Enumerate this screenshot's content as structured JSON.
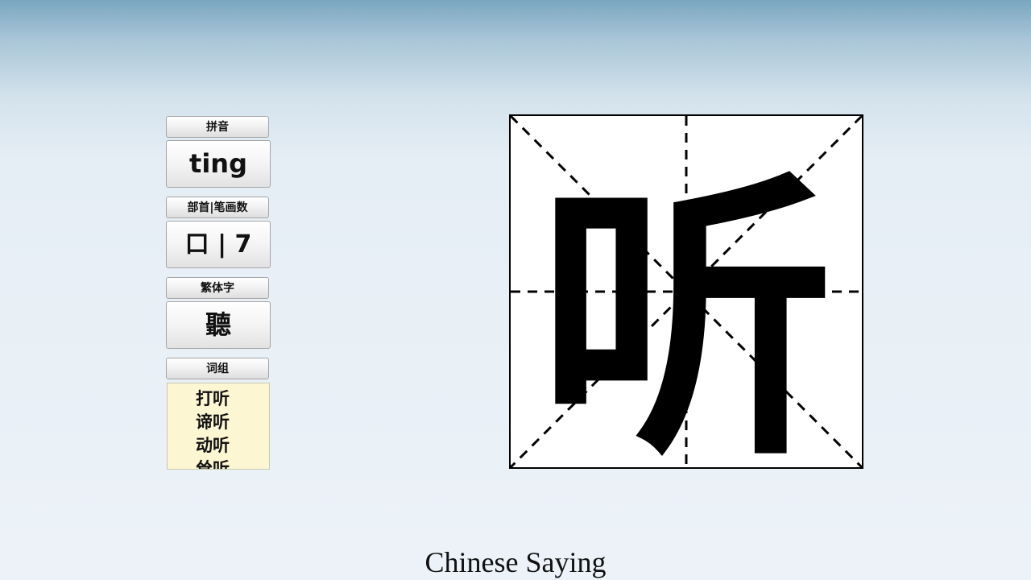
{
  "panel": {
    "pinyin": {
      "label": "拼音",
      "value": "ting"
    },
    "radical": {
      "label": "部首|笔画数",
      "value": "口 | 7"
    },
    "traditional": {
      "label": "繁体字",
      "value": "聽"
    },
    "words": {
      "label": "词组",
      "items": [
        "打听",
        "谛听",
        "动听",
        "耸听"
      ]
    }
  },
  "character": {
    "glyph": "听",
    "glyph_color": "#000000",
    "grid_background": "#ffffff",
    "grid_line_color": "#000000"
  },
  "footer": {
    "caption": "Chinese Saying"
  }
}
